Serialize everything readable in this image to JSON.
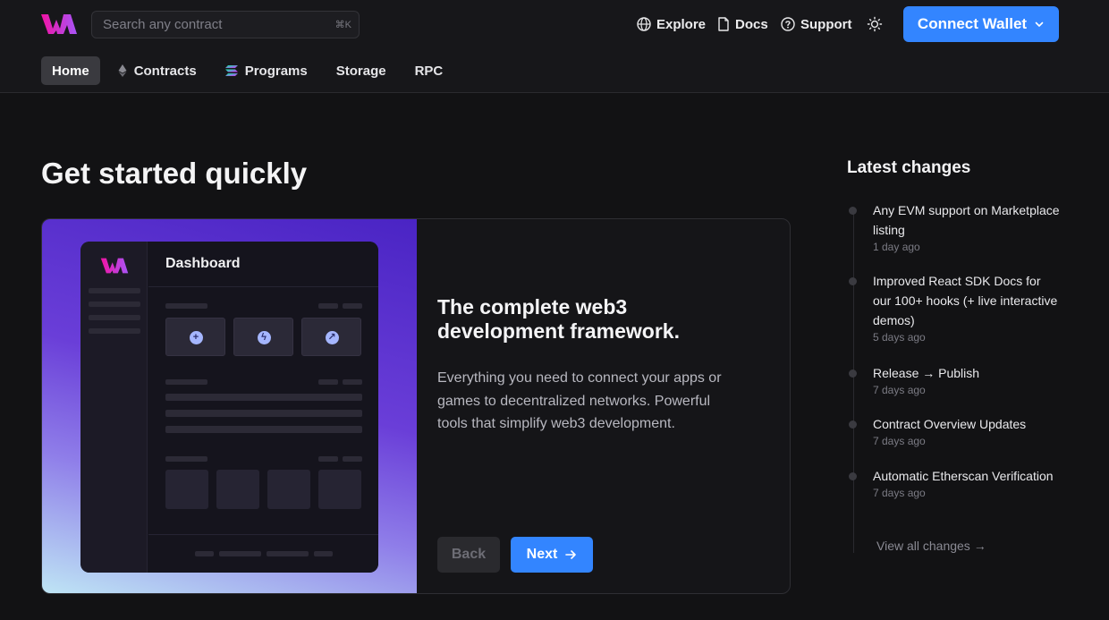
{
  "header": {
    "search_placeholder": "Search any contract",
    "search_shortcut": "⌘K",
    "links": [
      {
        "label": "Explore",
        "icon": "globe-icon"
      },
      {
        "label": "Docs",
        "icon": "document-icon"
      },
      {
        "label": "Support",
        "icon": "help-circle-icon"
      }
    ],
    "theme_icon": "sun-icon",
    "connect_label": "Connect Wallet",
    "accent": "#3385ff"
  },
  "nav": {
    "items": [
      {
        "label": "Home",
        "active": true
      },
      {
        "label": "Contracts",
        "icon": "ethereum-icon"
      },
      {
        "label": "Programs",
        "icon": "solana-icon"
      },
      {
        "label": "Storage"
      },
      {
        "label": "RPC"
      }
    ]
  },
  "main": {
    "title": "Get started quickly",
    "card": {
      "mock_title": "Dashboard",
      "heading": "The complete web3 development framework.",
      "body": "Everything you need to connect your apps or games to decentralized networks. Powerful tools that simplify web3 development.",
      "back_label": "Back",
      "next_label": "Next"
    }
  },
  "changes": {
    "title": "Latest changes",
    "items": [
      {
        "text": "Any EVM support on Marketplace listing",
        "time": "1 day ago"
      },
      {
        "text": "Improved React SDK Docs for our 100+ hooks (+ live interactive demos)",
        "time": "5 days ago"
      },
      {
        "text": "Release → Publish",
        "time": "7 days ago"
      },
      {
        "text": "Contract Overview Updates",
        "time": "7 days ago"
      },
      {
        "text": "Automatic Etherscan Verification",
        "time": "7 days ago"
      }
    ],
    "view_all": "View all changes →"
  }
}
